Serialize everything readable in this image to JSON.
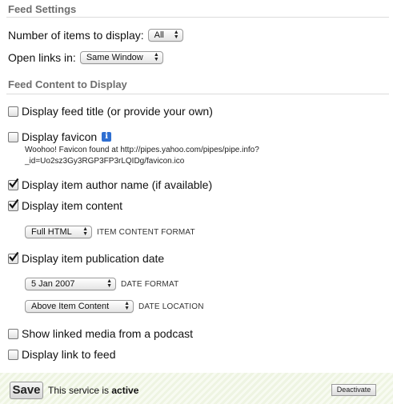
{
  "feed_settings": {
    "heading": "Feed Settings",
    "items_label": "Number of items to display:",
    "items_value": "All",
    "open_links_label": "Open links in:",
    "open_links_value": "Same Window"
  },
  "feed_content": {
    "heading": "Feed Content to Display",
    "display_title": {
      "label": "Display feed title (or provide your own)",
      "checked": false
    },
    "display_favicon": {
      "label": "Display favicon",
      "checked": false,
      "info_icon": "info-icon",
      "note_line1": "Woohoo! Favicon found at http://pipes.yahoo.com/pipes/pipe.info?",
      "note_line2": "_id=Uo2sz3Gy3RGP3FP3rLQIDg/favicon.ico"
    },
    "display_author": {
      "label": "Display item author name (if available)",
      "checked": true
    },
    "display_content": {
      "label": "Display item content",
      "checked": true,
      "format_value": "Full HTML",
      "format_caption": "ITEM CONTENT FORMAT"
    },
    "display_pubdate": {
      "label": "Display item publication date",
      "checked": true,
      "date_format_value": "5 Jan 2007",
      "date_format_caption": "DATE FORMAT",
      "date_location_value": "Above Item Content",
      "date_location_caption": "DATE LOCATION"
    },
    "linked_media": {
      "label": "Show linked media from a podcast",
      "checked": false
    },
    "link_to_feed": {
      "label": "Display link to feed",
      "checked": false
    }
  },
  "footer": {
    "save_label": "Save",
    "status_prefix": "This service is",
    "status_value": "active",
    "deactivate_label": "Deactivate"
  },
  "colors": {
    "heading": "#6e6e6e",
    "info_icon": "#2f6fd1",
    "footer_bg": "#eef4e2"
  }
}
